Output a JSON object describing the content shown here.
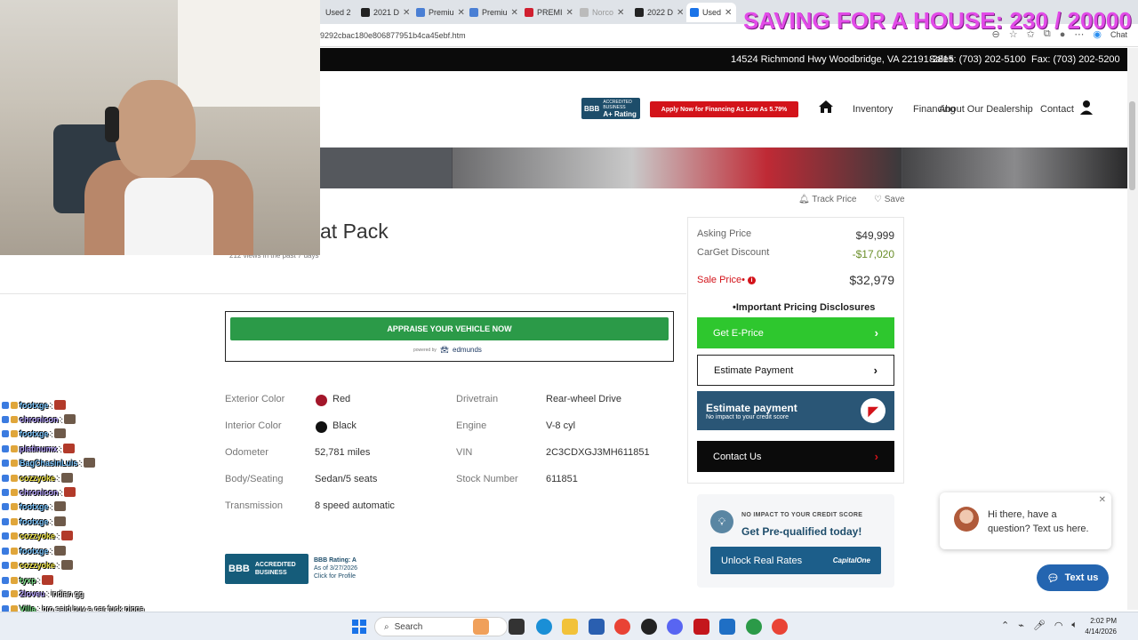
{
  "overlay": {
    "title": "SAVING FOR A HOUSE: 230 / 20000"
  },
  "browser": {
    "tabs": [
      {
        "label": "Used 2",
        "color": "#2d5fb0"
      },
      {
        "label": "2021 D",
        "color": "#222222"
      },
      {
        "label": "Premiu",
        "color": "#4a7fd4"
      },
      {
        "label": "Premiu",
        "color": "#4a7fd4"
      },
      {
        "label": "PREMI",
        "color": "#d01f2f"
      },
      {
        "label": "Norco",
        "color": "#888888"
      },
      {
        "label": "2022 D",
        "color": "#222222"
      },
      {
        "label": "Used",
        "color": "#1a73e8"
      }
    ],
    "url": "9292cbac180e806877951b4ca45ebf.htm",
    "chat_label": "Chat"
  },
  "dealer": {
    "address": "14524 Richmond Hwy Woodbridge, VA 22191-2815",
    "sales": "Sales: (703) 202-5100",
    "fax": "Fax: (703) 202-5200",
    "bbb_badge": "ACCREDITED BUSINESS",
    "bbb_grade": "A+ Rating",
    "apply_label": "Apply Now for Financing As Low As 5.79%",
    "nav": [
      "Inventory",
      "Financing",
      "About Our Dealership",
      "Contact"
    ]
  },
  "listing": {
    "track_price": "Track Price",
    "save": "Save",
    "title_partial": "at Pack",
    "views": "212 views in the past 7 days",
    "appraise_label": "APPRAISE YOUR VEHICLE NOW",
    "powered_by": "powered by",
    "edmunds": "edmunds",
    "specs_left": [
      {
        "label": "Exterior Color",
        "value": "Red",
        "swatch": "#a3162a"
      },
      {
        "label": "Interior Color",
        "value": "Black",
        "swatch": "#111111"
      },
      {
        "label": "Odometer",
        "value": "52,781 miles"
      },
      {
        "label": "Body/Seating",
        "value": "Sedan/5 seats"
      },
      {
        "label": "Transmission",
        "value": "8 speed automatic"
      }
    ],
    "specs_right": [
      {
        "label": "Drivetrain",
        "value": "Rear-wheel Drive"
      },
      {
        "label": "Engine",
        "value": "V-8 cyl"
      },
      {
        "label": "VIN",
        "value": "2C3CDXGJ3MH611851"
      },
      {
        "label": "Stock Number",
        "value": "611851"
      }
    ],
    "bbb_rating": "BBB Rating: A",
    "bbb_asof": "As of 3/27/2026",
    "bbb_click": "Click for Profile",
    "bbb_big_text": "ACCREDITED BUSINESS"
  },
  "pricing": {
    "asking_label": "Asking Price",
    "asking_value": "$49,999",
    "discount_label": "CarGet Discount",
    "discount_value": "-$17,020",
    "sale_label": "Sale Price•",
    "sale_value": "$32,979",
    "disclosures": "•Important Pricing Disclosures",
    "eprice": "Get E-Price",
    "estimate": "Estimate Payment",
    "estimate2_title": "Estimate payment",
    "estimate2_sub": "No impact to your credit score",
    "contact": "Contact Us",
    "accent_green": "#2ec72e",
    "accent_navy": "#1e4d6b"
  },
  "prequal": {
    "small": "NO IMPACT TO YOUR CREDIT SCORE",
    "big": "Get Pre-qualified today!",
    "unlock": "Unlock Real Rates",
    "capital_one": "CapitalOne"
  },
  "chat_widget": {
    "message": "Hi there, have a question? Text us here.",
    "button": "Text us"
  },
  "twitch_chat": [
    {
      "user": "footxge",
      "color": "#7ec8ff",
      "text": ":"
    },
    {
      "user": "chronicon",
      "color": "#b9a6ff",
      "text": ":"
    },
    {
      "user": "footxge",
      "color": "#7ec8ff",
      "text": ":"
    },
    {
      "user": "platinumx",
      "color": "#b9a6ff",
      "text": ":"
    },
    {
      "user": "BagChasinLuis",
      "color": "#7ec8ff",
      "text": ":"
    },
    {
      "user": "cozzyoke",
      "color": "#f2e74a",
      "text": ":"
    },
    {
      "user": "chronicon",
      "color": "#b9a6ff",
      "text": ":"
    },
    {
      "user": "footxge",
      "color": "#7ec8ff",
      "text": ":"
    },
    {
      "user": "footxge",
      "color": "#7ec8ff",
      "text": ":"
    },
    {
      "user": "cozzyoke",
      "color": "#f2e74a",
      "text": ":"
    },
    {
      "user": "footxge",
      "color": "#7ec8ff",
      "text": ":"
    },
    {
      "user": "cozzyoke",
      "color": "#f2e74a",
      "text": ":"
    },
    {
      "user": "tyxp",
      "color": "#7ee08a",
      "text": ":"
    },
    {
      "user": "2loveu",
      "color": "#b9a6ff",
      "text": ": indian gg"
    },
    {
      "user": "Villa",
      "color": "#7ee08a",
      "text": ": bro said buy a car fuck nigga"
    },
    {
      "user": "Villa",
      "color": "#7ee08a",
      "text": ":"
    }
  ],
  "taskbar": {
    "search": "Search",
    "time": "2:02 PM",
    "date": "4/14/2026"
  }
}
